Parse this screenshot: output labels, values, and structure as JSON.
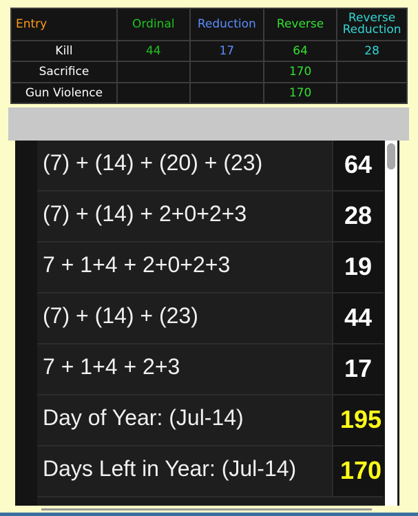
{
  "table": {
    "headers": {
      "entry": "Entry",
      "ordinal": "Ordinal",
      "reduction": "Reduction",
      "reverse": "Reverse",
      "reverse_reduction_1": "Reverse",
      "reverse_reduction_2": "Reduction"
    },
    "rows": [
      {
        "name": "Kill",
        "ordinal": "44",
        "reduction": "17",
        "reverse": "64",
        "reverse_reduction": "28"
      },
      {
        "name": "Sacrifice",
        "ordinal": "",
        "reduction": "",
        "reverse": "170",
        "reverse_reduction": ""
      },
      {
        "name": "Gun Violence",
        "ordinal": "",
        "reduction": "",
        "reverse": "170",
        "reverse_reduction": ""
      }
    ],
    "colors": {
      "entry": "#ff9c1a",
      "ordinal": "#1fc21f",
      "reduction": "#5b8dff",
      "reverse": "#33e033",
      "reverse_reduction": "#33d5d5"
    }
  },
  "calc_rows": [
    {
      "expression": "(7) + (14) + (20) + (23)",
      "value": "64"
    },
    {
      "expression": "(7) + (14) + 2+0+2+3",
      "value": "28"
    },
    {
      "expression": "7 + 1+4 + 2+0+2+3",
      "value": "19"
    },
    {
      "expression": "(7) + (14) + (23)",
      "value": "44"
    },
    {
      "expression": "7 + 1+4 + 2+3",
      "value": "17"
    },
    {
      "expression": "Day of Year: (Jul-14)",
      "value": "195"
    },
    {
      "expression": "Days Left in Year: (Jul-14)",
      "value": "170"
    }
  ],
  "highlight_color": "#ffff1a"
}
